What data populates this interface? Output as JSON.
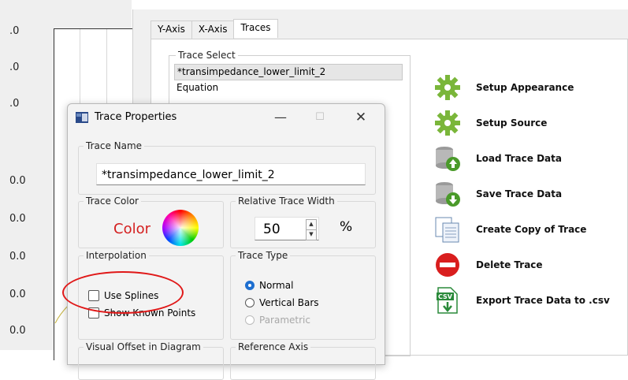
{
  "plot": {
    "tick_labels": [
      ".0",
      ".0",
      ".0",
      "0.0",
      "0.0",
      "0.0",
      "0.0",
      "0.0"
    ]
  },
  "main": {
    "tabs": [
      "Y-Axis",
      "X-Axis",
      "Traces"
    ],
    "active_tab": "Traces",
    "trace_select": {
      "legend": "Trace Select",
      "items": [
        "*transimpedance_lower_limit_2",
        "Equation"
      ],
      "selected_index": 0
    },
    "actions": [
      {
        "label": "Setup Appearance",
        "icon": "gear-icon"
      },
      {
        "label": "Setup Source",
        "icon": "gear-icon"
      },
      {
        "label": "Load Trace Data",
        "icon": "database-load-icon"
      },
      {
        "label": "Save Trace Data",
        "icon": "database-save-icon"
      },
      {
        "label": "Create Copy of Trace",
        "icon": "copy-documents-icon"
      },
      {
        "label": "Delete Trace",
        "icon": "delete-icon"
      },
      {
        "label": "Export Trace Data to .csv",
        "icon": "csv-export-icon"
      }
    ]
  },
  "dialog": {
    "title": "Trace Properties",
    "controls": {
      "minimize": "—",
      "maximize": "☐",
      "close": "✕"
    },
    "trace_name": {
      "legend": "Trace Name",
      "value": "*transimpedance_lower_limit_2"
    },
    "trace_color": {
      "legend": "Trace Color",
      "label": "Color",
      "color": "#d42020"
    },
    "relative_width": {
      "legend": "Relative Trace Width",
      "value": "50",
      "unit": "%"
    },
    "interpolation": {
      "legend": "Interpolation",
      "use_splines": "Use Splines",
      "show_known_points": "Show Known Points"
    },
    "trace_type": {
      "legend": "Trace Type",
      "options": [
        "Normal",
        "Vertical Bars",
        "Parametric"
      ],
      "selected": "Normal"
    },
    "visual_offset": {
      "legend": "Visual Offset in Diagram"
    },
    "reference_axis": {
      "legend": "Reference Axis"
    }
  },
  "colors": {
    "annotation": "#e01818",
    "accent": "#1e6fd0",
    "gear": "#7ab63a"
  }
}
